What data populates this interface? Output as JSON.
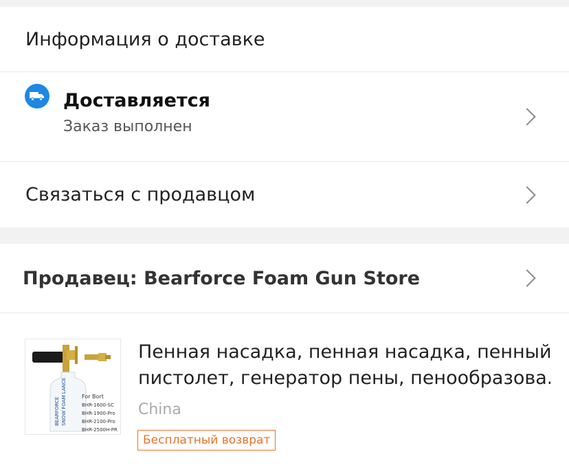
{
  "delivery_info": {
    "header": "Информация о доставке",
    "status": {
      "icon": "truck-icon",
      "title": "Доставляется",
      "subtitle": "Заказ выполнен"
    },
    "contact_seller": "Связаться с продавцом"
  },
  "seller": {
    "label": "Продавец: Bearforce Foam Gun Store"
  },
  "product": {
    "title_line1": "Пенная насадка, пенная насадка, пенный",
    "title_line2": "пистолет, генератор пены, пенообразова...",
    "origin": "China",
    "return_badge": "Бесплатный возврат",
    "image_text": {
      "brand": "BEARFORCE",
      "product": "SNOW FOAM LANCE",
      "for_label": "For Bort",
      "models": [
        "BHR-1600-SC",
        "BHR-1900-Pro",
        "BHR-2100-Pro",
        "BHR-2500H-PR"
      ]
    }
  },
  "colors": {
    "accent_blue": "#1e88e5",
    "badge_orange": "#e8742a",
    "separator_gray": "#f2f2f2"
  }
}
